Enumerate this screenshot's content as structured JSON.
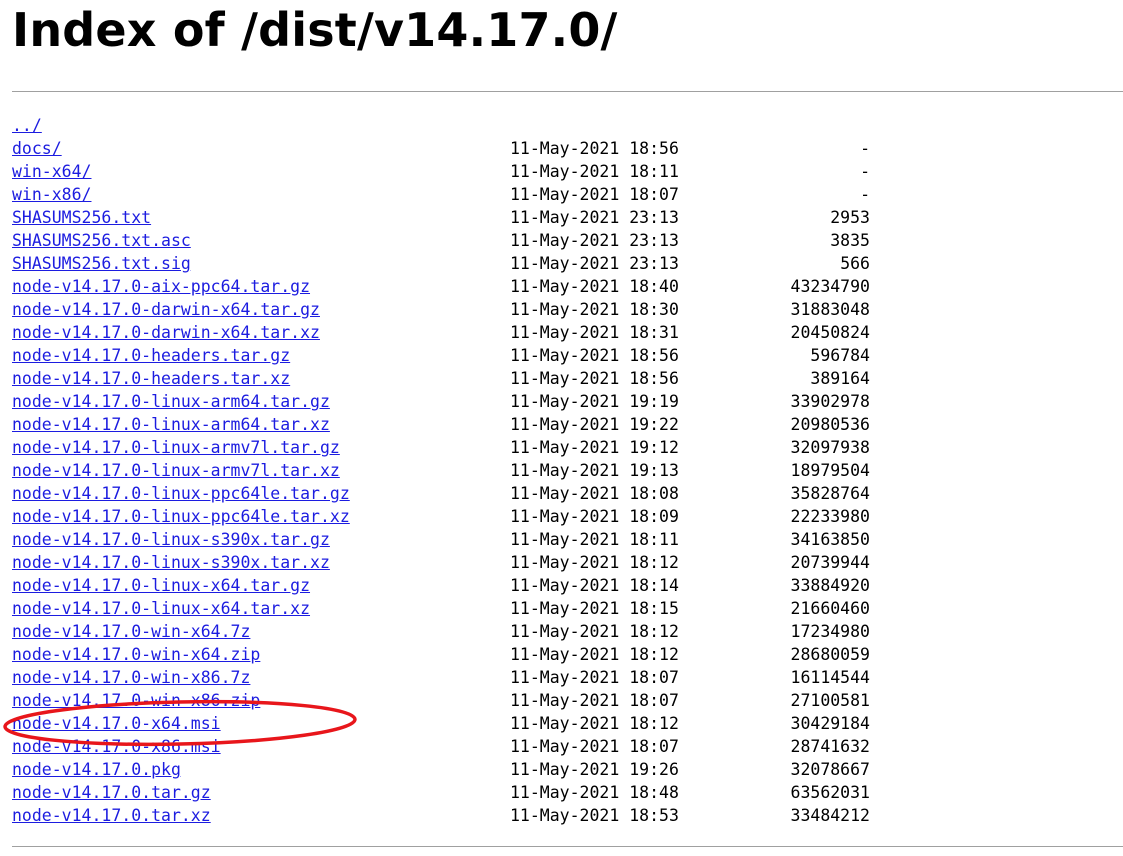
{
  "title": "Index of /dist/v14.17.0/",
  "entries": [
    {
      "name": "../",
      "date": "",
      "size": ""
    },
    {
      "name": "docs/",
      "date": "11-May-2021 18:56",
      "size": "-"
    },
    {
      "name": "win-x64/",
      "date": "11-May-2021 18:11",
      "size": "-"
    },
    {
      "name": "win-x86/",
      "date": "11-May-2021 18:07",
      "size": "-"
    },
    {
      "name": "SHASUMS256.txt",
      "date": "11-May-2021 23:13",
      "size": "2953"
    },
    {
      "name": "SHASUMS256.txt.asc",
      "date": "11-May-2021 23:13",
      "size": "3835"
    },
    {
      "name": "SHASUMS256.txt.sig",
      "date": "11-May-2021 23:13",
      "size": "566"
    },
    {
      "name": "node-v14.17.0-aix-ppc64.tar.gz",
      "date": "11-May-2021 18:40",
      "size": "43234790"
    },
    {
      "name": "node-v14.17.0-darwin-x64.tar.gz",
      "date": "11-May-2021 18:30",
      "size": "31883048"
    },
    {
      "name": "node-v14.17.0-darwin-x64.tar.xz",
      "date": "11-May-2021 18:31",
      "size": "20450824"
    },
    {
      "name": "node-v14.17.0-headers.tar.gz",
      "date": "11-May-2021 18:56",
      "size": "596784"
    },
    {
      "name": "node-v14.17.0-headers.tar.xz",
      "date": "11-May-2021 18:56",
      "size": "389164"
    },
    {
      "name": "node-v14.17.0-linux-arm64.tar.gz",
      "date": "11-May-2021 19:19",
      "size": "33902978"
    },
    {
      "name": "node-v14.17.0-linux-arm64.tar.xz",
      "date": "11-May-2021 19:22",
      "size": "20980536"
    },
    {
      "name": "node-v14.17.0-linux-armv7l.tar.gz",
      "date": "11-May-2021 19:12",
      "size": "32097938"
    },
    {
      "name": "node-v14.17.0-linux-armv7l.tar.xz",
      "date": "11-May-2021 19:13",
      "size": "18979504"
    },
    {
      "name": "node-v14.17.0-linux-ppc64le.tar.gz",
      "date": "11-May-2021 18:08",
      "size": "35828764"
    },
    {
      "name": "node-v14.17.0-linux-ppc64le.tar.xz",
      "date": "11-May-2021 18:09",
      "size": "22233980"
    },
    {
      "name": "node-v14.17.0-linux-s390x.tar.gz",
      "date": "11-May-2021 18:11",
      "size": "34163850"
    },
    {
      "name": "node-v14.17.0-linux-s390x.tar.xz",
      "date": "11-May-2021 18:12",
      "size": "20739944"
    },
    {
      "name": "node-v14.17.0-linux-x64.tar.gz",
      "date": "11-May-2021 18:14",
      "size": "33884920"
    },
    {
      "name": "node-v14.17.0-linux-x64.tar.xz",
      "date": "11-May-2021 18:15",
      "size": "21660460"
    },
    {
      "name": "node-v14.17.0-win-x64.7z",
      "date": "11-May-2021 18:12",
      "size": "17234980"
    },
    {
      "name": "node-v14.17.0-win-x64.zip",
      "date": "11-May-2021 18:12",
      "size": "28680059"
    },
    {
      "name": "node-v14.17.0-win-x86.7z",
      "date": "11-May-2021 18:07",
      "size": "16114544"
    },
    {
      "name": "node-v14.17.0-win-x86.zip",
      "date": "11-May-2021 18:07",
      "size": "27100581"
    },
    {
      "name": "node-v14.17.0-x64.msi",
      "date": "11-May-2021 18:12",
      "size": "30429184"
    },
    {
      "name": "node-v14.17.0-x86.msi",
      "date": "11-May-2021 18:07",
      "size": "28741632"
    },
    {
      "name": "node-v14.17.0.pkg",
      "date": "11-May-2021 19:26",
      "size": "32078667"
    },
    {
      "name": "node-v14.17.0.tar.gz",
      "date": "11-May-2021 18:48",
      "size": "63562031"
    },
    {
      "name": "node-v14.17.0.tar.xz",
      "date": "11-May-2021 18:53",
      "size": "33484212"
    }
  ],
  "colors": {
    "link": "#1c1ce0",
    "annotation": "#e8161b"
  }
}
